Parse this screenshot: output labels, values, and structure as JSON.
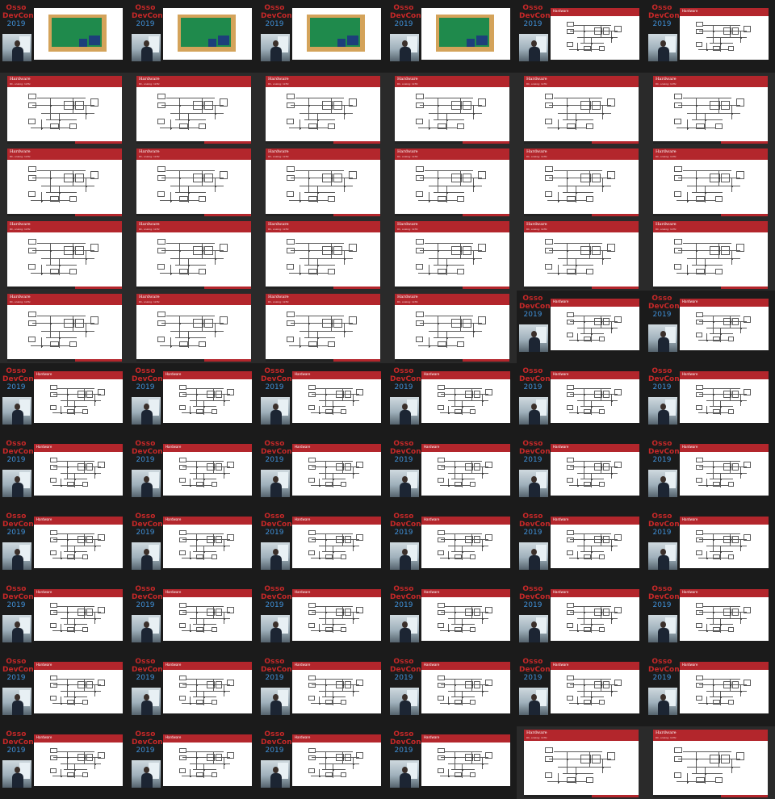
{
  "logo": {
    "line1": "Osso",
    "line2": "DevCon",
    "line3": "2019"
  },
  "slide": {
    "title": "Hardware",
    "subtitle": "RC, analog: 1kHz"
  },
  "colors": {
    "brand_red": "#b3262c",
    "year_blue": "#3f8fd6",
    "background": "#161616"
  },
  "tiles": [
    "speaker-pcb",
    "speaker-pcb",
    "speaker-pcb",
    "speaker-pcb",
    "speaker-schem",
    "speaker-schem",
    "slide",
    "slide",
    "slide",
    "slide",
    "slide",
    "slide",
    "slide",
    "slide",
    "slide",
    "slide",
    "slide",
    "slide",
    "slide",
    "slide",
    "slide",
    "slide",
    "slide",
    "slide",
    "slide",
    "slide",
    "slide",
    "slide",
    "speaker-schem",
    "speaker-schem",
    "speaker-schem",
    "speaker-schem",
    "speaker-schem",
    "speaker-schem",
    "speaker-schem",
    "speaker-schem",
    "speaker-schem",
    "speaker-schem",
    "speaker-schem",
    "speaker-schem",
    "speaker-schem",
    "speaker-schem",
    "speaker-schem",
    "speaker-schem",
    "speaker-schem",
    "speaker-schem",
    "speaker-schem",
    "speaker-schem",
    "speaker-schem",
    "speaker-schem",
    "speaker-schem",
    "speaker-schem",
    "speaker-schem",
    "speaker-schem",
    "speaker-schem",
    "speaker-schem",
    "speaker-schem",
    "speaker-schem",
    "speaker-schem",
    "speaker-schem",
    "speaker-schem",
    "speaker-schem",
    "speaker-schem",
    "speaker-schem",
    "slide",
    "slide"
  ]
}
